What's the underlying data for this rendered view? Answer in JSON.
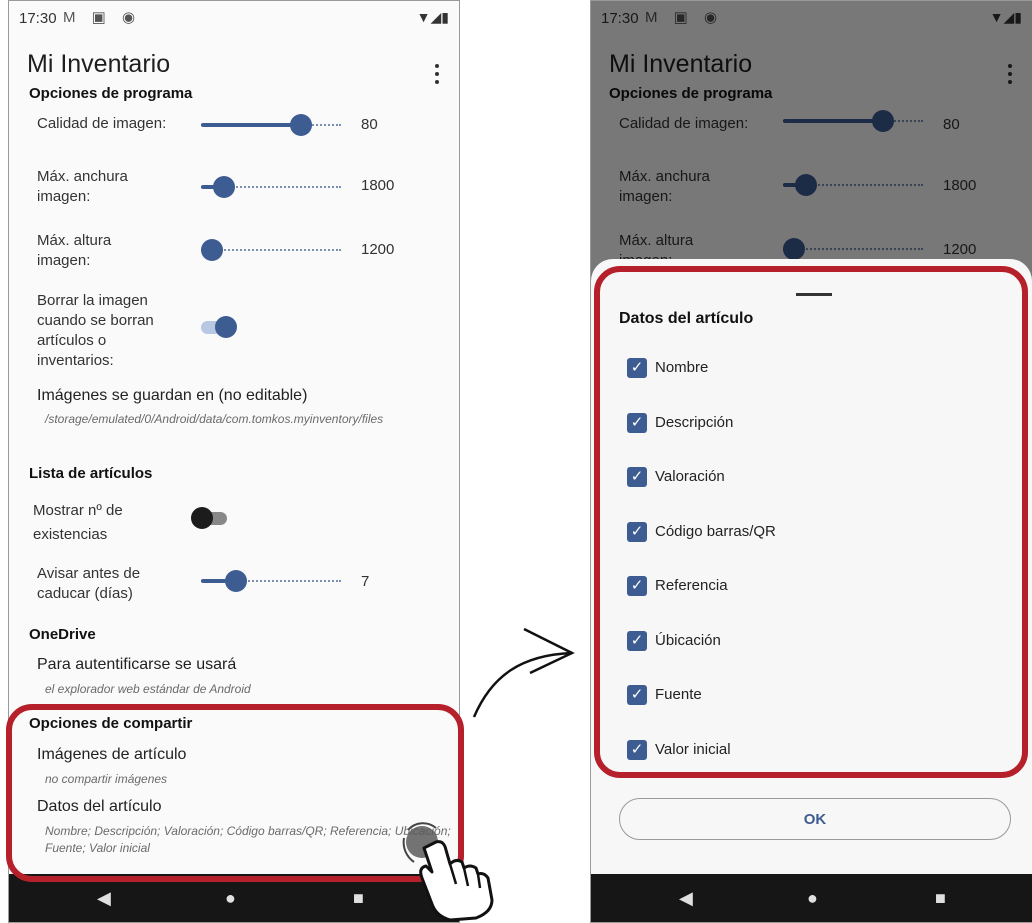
{
  "status": {
    "time": "17:30",
    "notif_icons": "M ▣ ◉",
    "system_icons": "▼◢▮"
  },
  "app": {
    "title": "Mi Inventario",
    "menu_icon": "kebab-menu-icon"
  },
  "program_options": {
    "header": "Opciones de programa",
    "image_quality": {
      "label": "Calidad de imagen:",
      "value": "80",
      "fraction": 0.75
    },
    "max_width": {
      "label": "Máx. anchura imagen:",
      "value": "1800",
      "fraction": 0.1
    },
    "max_height": {
      "label": "Máx. altura imagen:",
      "value": "1200",
      "fraction": 0.0
    },
    "delete_images": {
      "label": "Borrar la imagen cuando se borran artículos o inventarios:",
      "on": true
    },
    "storage": {
      "title": "Imágenes se guardan en (no editable)",
      "path": "/storage/emulated/0/Android/data/com.tomkos.myinventory/files"
    }
  },
  "item_list": {
    "header": "Lista de artículos",
    "show_stock": {
      "label": "Mostrar nº de existencias",
      "on": false
    },
    "expiry_warn": {
      "label": "Avisar antes de caducar (días)",
      "value": "7",
      "fraction": 0.2
    }
  },
  "onedrive": {
    "header": "OneDrive",
    "auth_title": "Para autentificarse se usará",
    "auth_sub": "el explorador web estándar de Android"
  },
  "share_options": {
    "header": "Opciones de compartir",
    "images_title": "Imágenes de artículo",
    "images_sub": "no compartir imágenes",
    "data_title": "Datos del artículo",
    "data_sub": "Nombre; Descripción; Valoración; Código barras/QR; Referencia; Ubicación; Fuente; Valor inicial"
  },
  "sheet": {
    "title": "Datos del artículo",
    "items": [
      {
        "label": "Nombre",
        "checked": true
      },
      {
        "label": "Descripción",
        "checked": true
      },
      {
        "label": "Valoración",
        "checked": true
      },
      {
        "label": "Código barras/QR",
        "checked": true
      },
      {
        "label": "Referencia",
        "checked": true
      },
      {
        "label": "Úbicación",
        "checked": true
      },
      {
        "label": "Fuente",
        "checked": true
      },
      {
        "label": "Valor inicial",
        "checked": true
      }
    ],
    "ok_label": "OK"
  },
  "colors": {
    "accent": "#3d5c92",
    "highlight": "#b5202a",
    "navbar": "#161616"
  }
}
